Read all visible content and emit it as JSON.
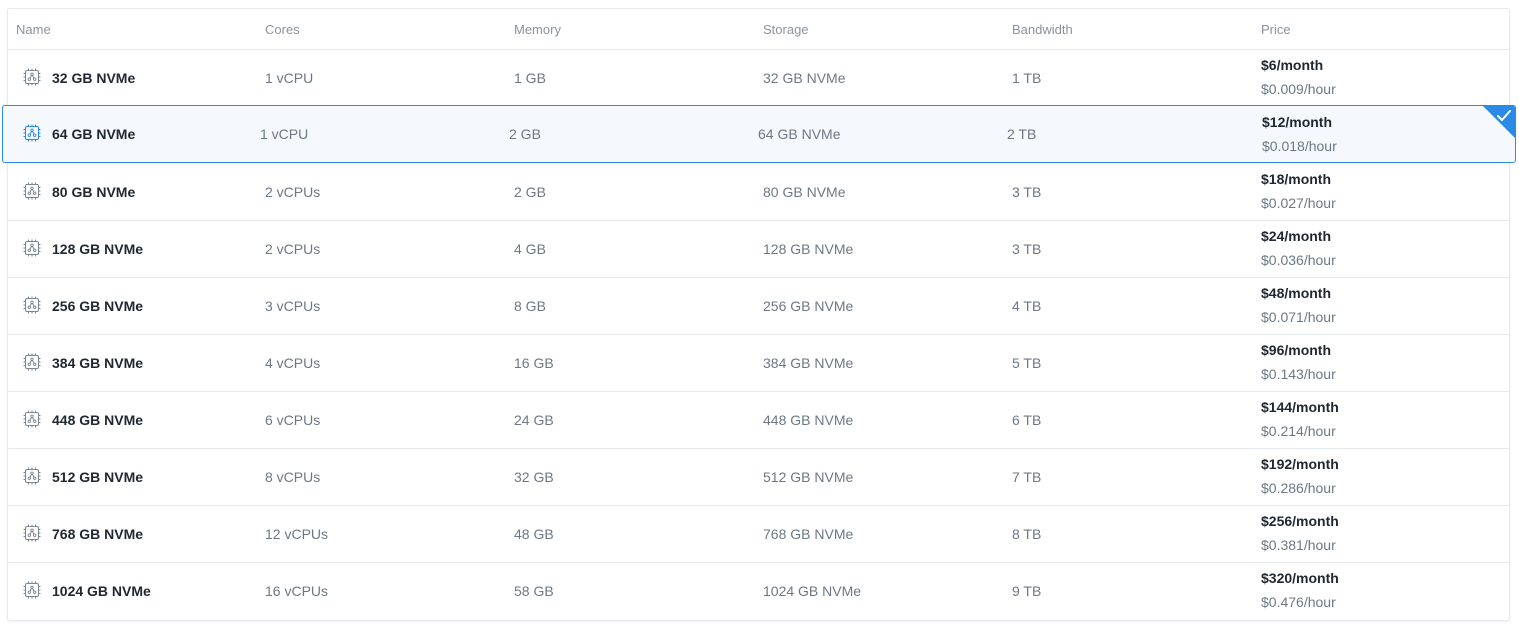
{
  "columns": [
    "Name",
    "Cores",
    "Memory",
    "Storage",
    "Bandwidth",
    "Price"
  ],
  "icon": "server-chip-icon",
  "accent_color": "#2b8ae6",
  "selected_row_index": 1,
  "rows": [
    {
      "name": "32 GB NVMe",
      "cores": "1 vCPU",
      "memory": "1 GB",
      "storage": "32 GB NVMe",
      "bandwidth": "1 TB",
      "price_month": "$6/month",
      "price_hour": "$0.009/hour"
    },
    {
      "name": "64 GB NVMe",
      "cores": "1 vCPU",
      "memory": "2 GB",
      "storage": "64 GB NVMe",
      "bandwidth": "2 TB",
      "price_month": "$12/month",
      "price_hour": "$0.018/hour"
    },
    {
      "name": "80 GB NVMe",
      "cores": "2 vCPUs",
      "memory": "2 GB",
      "storage": "80 GB NVMe",
      "bandwidth": "3 TB",
      "price_month": "$18/month",
      "price_hour": "$0.027/hour"
    },
    {
      "name": "128 GB NVMe",
      "cores": "2 vCPUs",
      "memory": "4 GB",
      "storage": "128 GB NVMe",
      "bandwidth": "3 TB",
      "price_month": "$24/month",
      "price_hour": "$0.036/hour"
    },
    {
      "name": "256 GB NVMe",
      "cores": "3 vCPUs",
      "memory": "8 GB",
      "storage": "256 GB NVMe",
      "bandwidth": "4 TB",
      "price_month": "$48/month",
      "price_hour": "$0.071/hour"
    },
    {
      "name": "384 GB NVMe",
      "cores": "4 vCPUs",
      "memory": "16 GB",
      "storage": "384 GB NVMe",
      "bandwidth": "5 TB",
      "price_month": "$96/month",
      "price_hour": "$0.143/hour"
    },
    {
      "name": "448 GB NVMe",
      "cores": "6 vCPUs",
      "memory": "24 GB",
      "storage": "448 GB NVMe",
      "bandwidth": "6 TB",
      "price_month": "$144/month",
      "price_hour": "$0.214/hour"
    },
    {
      "name": "512 GB NVMe",
      "cores": "8 vCPUs",
      "memory": "32 GB",
      "storage": "512 GB NVMe",
      "bandwidth": "7 TB",
      "price_month": "$192/month",
      "price_hour": "$0.286/hour"
    },
    {
      "name": "768 GB NVMe",
      "cores": "12 vCPUs",
      "memory": "48 GB",
      "storage": "768 GB NVMe",
      "bandwidth": "8 TB",
      "price_month": "$256/month",
      "price_hour": "$0.381/hour"
    },
    {
      "name": "1024 GB NVMe",
      "cores": "16 vCPUs",
      "memory": "58 GB",
      "storage": "1024 GB NVMe",
      "bandwidth": "9 TB",
      "price_month": "$320/month",
      "price_hour": "$0.476/hour"
    }
  ]
}
